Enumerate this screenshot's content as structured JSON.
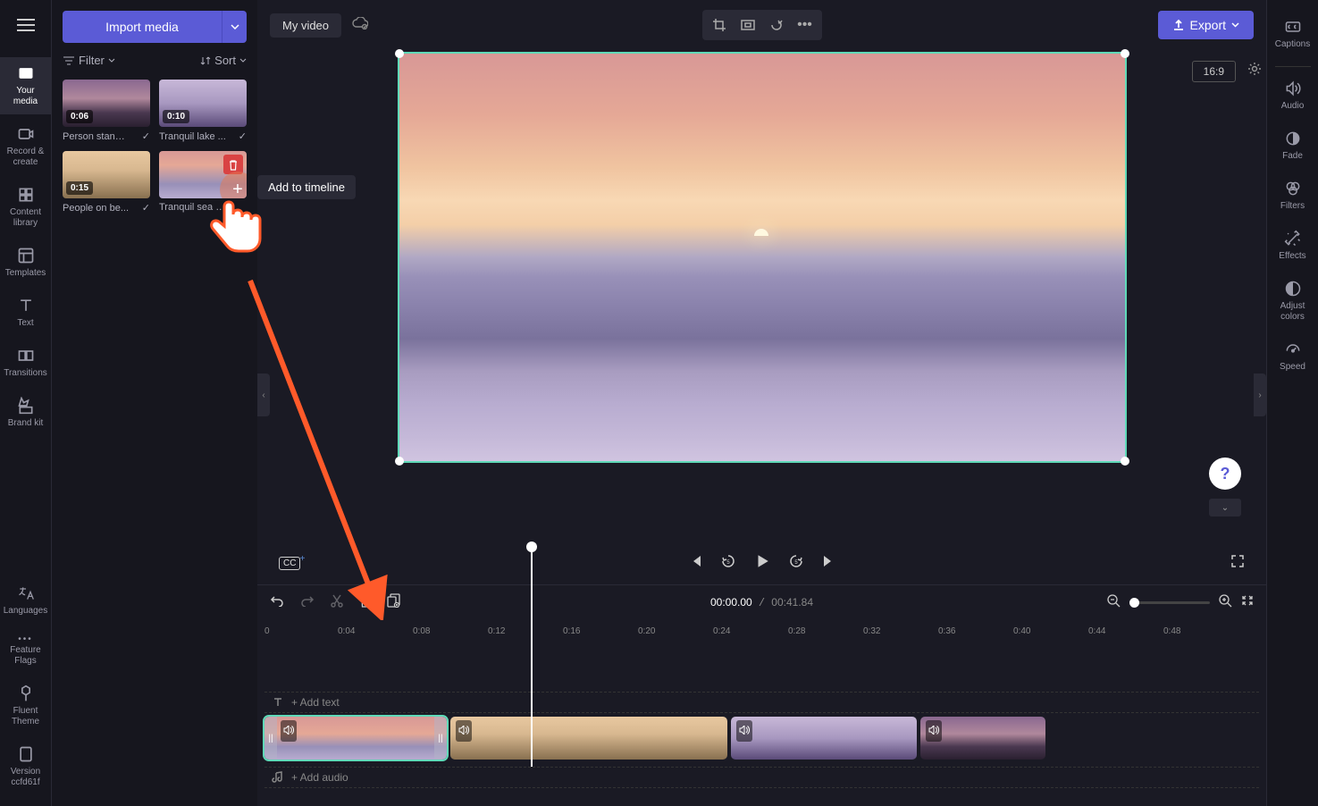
{
  "leftRail": {
    "items": [
      {
        "label": "Your media"
      },
      {
        "label": "Record & create"
      },
      {
        "label": "Content library"
      },
      {
        "label": "Templates"
      },
      {
        "label": "Text"
      },
      {
        "label": "Transitions"
      },
      {
        "label": "Brand kit"
      }
    ],
    "bottom": [
      {
        "label": "Languages"
      },
      {
        "label": "Feature Flags"
      },
      {
        "label": "Fluent Theme"
      },
      {
        "label": "Version ccfd61f"
      }
    ]
  },
  "mediaPanel": {
    "importLabel": "Import media",
    "filterLabel": "Filter",
    "sortLabel": "Sort",
    "items": [
      {
        "duration": "0:06",
        "name": "Person standi...",
        "used": true
      },
      {
        "duration": "0:10",
        "name": "Tranquil lake ...",
        "used": true
      },
      {
        "duration": "0:15",
        "name": "People on be...",
        "used": true
      },
      {
        "duration": "",
        "name": "Tranquil sea a...",
        "hover": true
      }
    ]
  },
  "tooltip": "Add to timeline",
  "topBar": {
    "title": "My video",
    "exportLabel": "Export",
    "aspect": "16:9"
  },
  "playback": {
    "currentTime": "00:00.00",
    "totalTime": "00:41.84"
  },
  "ruler": [
    "0",
    "0:04",
    "0:08",
    "0:12",
    "0:16",
    "0:20",
    "0:24",
    "0:28",
    "0:32",
    "0:36",
    "0:40",
    "0:44",
    "0:48"
  ],
  "tracks": {
    "addText": "+ Add text",
    "addAudio": "+ Add audio"
  },
  "rightRail": [
    {
      "label": "Captions"
    },
    {
      "label": "Audio"
    },
    {
      "label": "Fade"
    },
    {
      "label": "Filters"
    },
    {
      "label": "Effects"
    },
    {
      "label": "Adjust colors"
    },
    {
      "label": "Speed"
    }
  ]
}
